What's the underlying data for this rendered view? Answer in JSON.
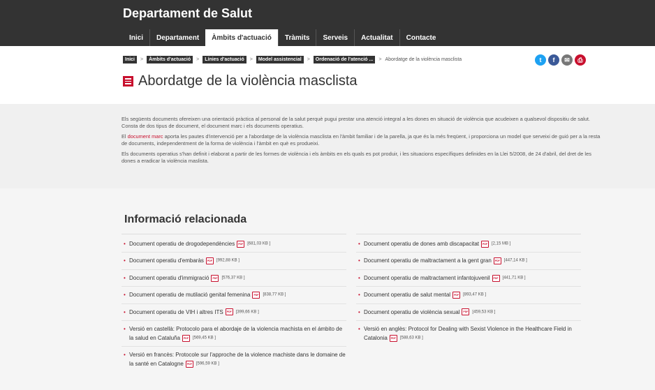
{
  "header": {
    "site_title": "Departament de Salut",
    "nav": [
      {
        "label": "Inici"
      },
      {
        "label": "Departament"
      },
      {
        "label": "Àmbits d'actuació",
        "active": true
      },
      {
        "label": "Tràmits"
      },
      {
        "label": "Serveis"
      },
      {
        "label": "Actualitat"
      },
      {
        "label": "Contacte"
      }
    ]
  },
  "breadcrumb": {
    "items": [
      "Inici",
      "Àmbits d'actuació",
      "Línies d'actuació",
      "Model assistencial",
      "Ordenació de l'atenció ..."
    ],
    "separator": ">",
    "current": "Abordatge de la violència masclista"
  },
  "share": [
    {
      "icon": "twitter-icon",
      "glyph": "t",
      "color": "#1da1f2"
    },
    {
      "icon": "facebook-icon",
      "glyph": "f",
      "color": "#3b5998"
    },
    {
      "icon": "email-icon",
      "glyph": "✉",
      "color": "#777777"
    },
    {
      "icon": "print-icon",
      "glyph": "⎙",
      "color": "#c8102e"
    }
  ],
  "page_title": "Abordatge de la violència masclista",
  "intro": {
    "p1": "Els següents documents ofereixen una orientació pràctica al personal de la salut perquè pugui prestar una atenció integral a les dones en situació de violència que acudeixen a qualsevol dispositiu de salut. Consta de dos tipus de document, el document marc i els documents operatius.",
    "p2_prefix": "El ",
    "p2_link": "document marc",
    "p2_suffix": " aporta les pautes d'intervenció per a l'abordatge de la violència masclista en l'àmbit familiar i de la parella, ja que és la més freqüent, i proporciona un model que serveixi de guió per a la resta de documents, independentment de la forma de violència i l'àmbit en què es produeixi.",
    "p3": "Els documents operatius s'han definit i elaborat a partir de les formes de violència i els àmbits en els quals es pot produir, i les situacions específiques definides en la Llei 5/2008, de 24 d'abril, del dret de les dones a eradicar la violència maslista."
  },
  "related": {
    "title": "Informació relacionada",
    "pdf_label": "PDF",
    "left": [
      {
        "label": "Document operatiu de drogodependències",
        "size": "[681,03 KB ]"
      },
      {
        "label": "Document operatiu d'embaràs",
        "size": "[992,88 KB ]"
      },
      {
        "label": "Document operatiu d'immigració",
        "size": "[576,37 KB ]"
      },
      {
        "label": "Document operatiu de mutilació genital femenina",
        "size": "[838,77 KB ]"
      },
      {
        "label": "Document operatiu de VIH i altres ITS",
        "size": "[399,66 KB ]"
      },
      {
        "label": "Versió en castellà: Protocolo para el abordaje de la violencia machista en el ámbito de la salud en Cataluña",
        "size": "[569,45 KB ]"
      },
      {
        "label": "Versió en francès: Protocole sur l'approche de la violence machiste dans le domaine de la santé en Catalogne",
        "size": "[596,59 KB ]"
      }
    ],
    "right": [
      {
        "label": "Document operatiu de dones amb discapacitat",
        "size": "[2,15 MB ]"
      },
      {
        "label": "Document operatiu de maltractament a la gent gran",
        "size": "[447,14 KB ]"
      },
      {
        "label": "Document operatiu de maltractament infantojuvenil",
        "size": "[441,71 KB ]"
      },
      {
        "label": "Document operatiu de salut mental",
        "size": "[893,47 KB ]"
      },
      {
        "label": "Document operatiu de violència sexual",
        "size": "[459,53 KB ]"
      },
      {
        "label": "Versió en anglès: Protocol for Dealing with Sexist Violence in the Healthcare Field in Catalonia",
        "size": "[588,63 KB ]"
      }
    ]
  }
}
